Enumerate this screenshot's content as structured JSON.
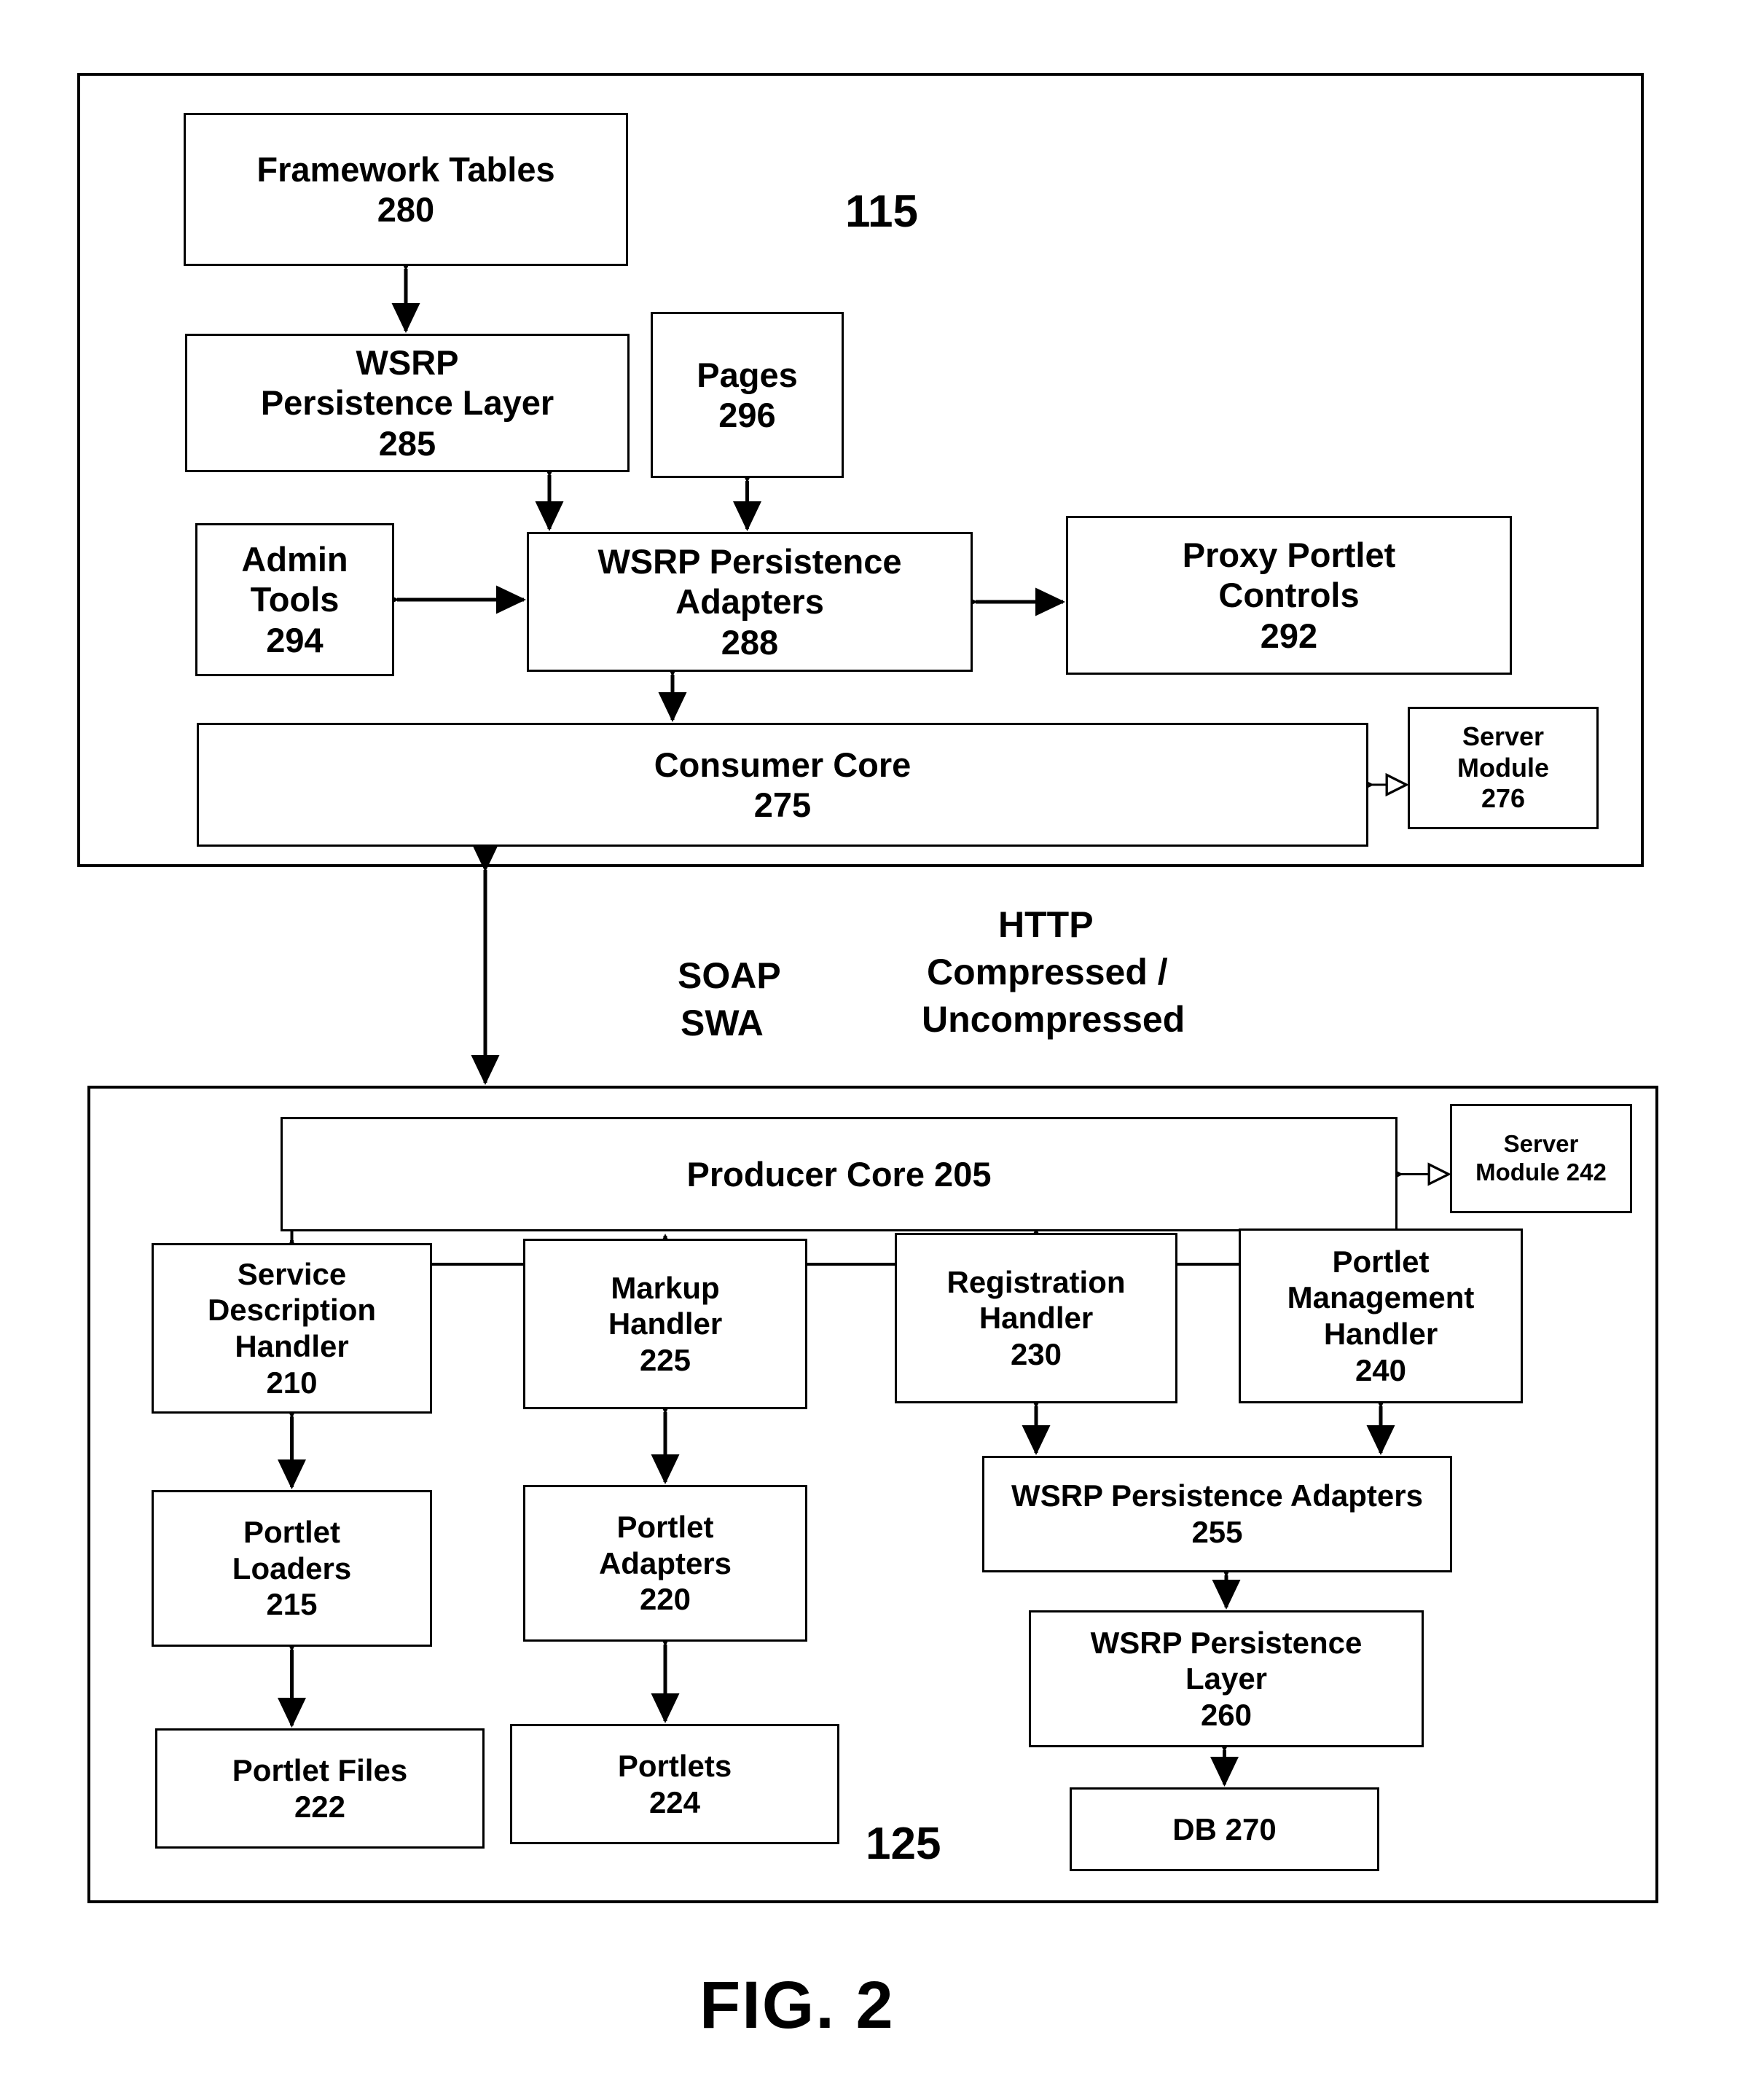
{
  "figure": {
    "caption": "FIG. 2"
  },
  "consumer": {
    "ref_label": "115",
    "boxes": {
      "framework_tables": {
        "line1": "Framework Tables",
        "line2": "280"
      },
      "wsrp_persistence_layer": {
        "line1": "WSRP",
        "line2": "Persistence Layer",
        "line3": "285"
      },
      "pages": {
        "line1": "Pages",
        "line2": "296"
      },
      "admin_tools": {
        "line1": "Admin",
        "line2": "Tools",
        "line3": "294"
      },
      "wsrp_persistence_adapters": {
        "line1": "WSRP Persistence",
        "line2": "Adapters",
        "line3": "288"
      },
      "proxy_portlet_controls": {
        "line1": "Proxy Portlet",
        "line2": "Controls",
        "line3": "292"
      },
      "consumer_core": {
        "line1": "Consumer Core",
        "line2": "275"
      },
      "server_module": {
        "line1": "Server",
        "line2": "Module",
        "line3": "276"
      }
    }
  },
  "link": {
    "left_label_line1": "SOAP",
    "left_label_line2": "SWA",
    "right_label_line1": "HTTP",
    "right_label_line2": "Compressed /",
    "right_label_line3": "Uncompressed"
  },
  "producer": {
    "ref_label": "125",
    "boxes": {
      "producer_core": {
        "line1": "Producer Core 205"
      },
      "server_module": {
        "line1": "Server",
        "line2": "Module 242"
      },
      "service_description_handler": {
        "line1": "Service",
        "line2": "Description",
        "line3": "Handler",
        "line4": "210"
      },
      "markup_handler": {
        "line1": "Markup",
        "line2": "Handler",
        "line3": "225"
      },
      "registration_handler": {
        "line1": "Registration",
        "line2": "Handler",
        "line3": "230"
      },
      "portlet_management_handler": {
        "line1": "Portlet",
        "line2": "Management",
        "line3": "Handler",
        "line4": "240"
      },
      "portlet_loaders": {
        "line1": "Portlet",
        "line2": "Loaders",
        "line3": "215"
      },
      "portlet_adapters": {
        "line1": "Portlet",
        "line2": "Adapters",
        "line3": "220"
      },
      "wsrp_persistence_adapters": {
        "line1": "WSRP Persistence Adapters",
        "line2": "255"
      },
      "wsrp_persistence_layer": {
        "line1": "WSRP Persistence",
        "line2": "Layer",
        "line3": "260"
      },
      "portlet_files": {
        "line1": "Portlet Files",
        "line2": "222"
      },
      "portlets": {
        "line1": "Portlets",
        "line2": "224"
      },
      "db": {
        "line1": "DB 270"
      }
    }
  },
  "colors": {
    "stroke": "#000000",
    "background": "#ffffff"
  }
}
